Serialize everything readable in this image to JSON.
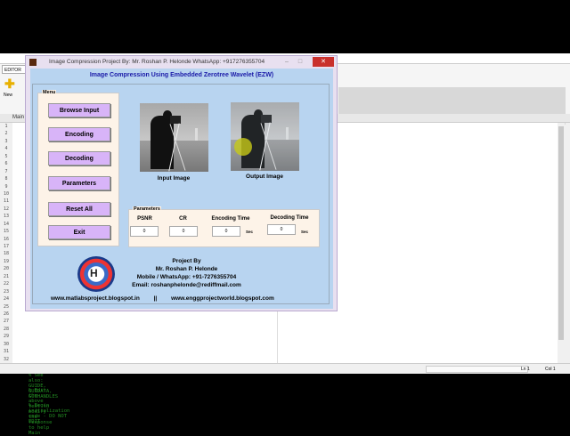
{
  "matlab": {
    "editor_tab": "EDITOR",
    "new_label": "New",
    "main_tab": "Main",
    "line_numbers": [
      1,
      2,
      3,
      4,
      5,
      6,
      7,
      8,
      9,
      10,
      11,
      12,
      13,
      14,
      15,
      16,
      17,
      18,
      19,
      20,
      21,
      22,
      23,
      24,
      25,
      26,
      27,
      28,
      29,
      30,
      31,
      32
    ],
    "code_lines": [
      {
        "line": 26,
        "text": "%"
      },
      {
        "line": 27,
        "text": "% See also: GUIDE, GUIDATA, GUIHANDLES"
      },
      {
        "line": 29,
        "text": "% Edit the above text to modify the response to help Main"
      },
      {
        "line": 31,
        "text": "% Begin initialization code - DO NOT EDIT"
      }
    ],
    "status": {
      "ln": "Ln 1",
      "col": "Col 1"
    }
  },
  "figure": {
    "title": "Image Compression   Project By: Mr. Roshan P. Helonde   WhatsApp: +917276355704",
    "heading": "Image Compression Using Embedded Zerotree Wavelet (EZW)",
    "menu": {
      "label": "Menu",
      "buttons": [
        "Browse Input",
        "Encoding",
        "Decoding",
        "Parameters",
        "Reset All",
        "Exit"
      ]
    },
    "input_caption": "Input Image",
    "output_caption": "Output Image",
    "parameters": {
      "label": "Parameters",
      "psnr_label": "PSNR",
      "psnr": "0",
      "cr_label": "CR",
      "cr": "0",
      "enc_label": "Encoding Time",
      "enc": "0",
      "dec_label": "Decoding Time",
      "dec": "0",
      "unit": "Sec"
    },
    "info": {
      "l1": "Project By",
      "l2": "Mr. Roshan P. Helonde",
      "l3": "Mobile / WhatsApp: +91-7276355704",
      "l4": "Email: roshanphelonde@rediffmail.com"
    },
    "link1": "www.matlabsproject.blogspot.in",
    "sep": "||",
    "link2": "www.enggprojectworld.blogspot.com"
  }
}
